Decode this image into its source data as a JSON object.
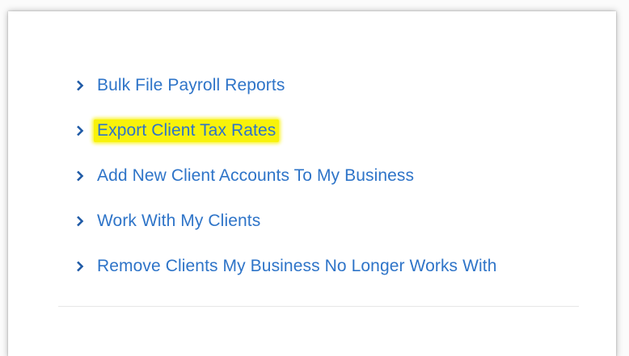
{
  "menu": {
    "items": [
      {
        "label": "Bulk File Payroll Reports",
        "icon": "chevron-right-icon",
        "highlighted": false
      },
      {
        "label": "Export Client Tax Rates",
        "icon": "chevron-right-icon",
        "highlighted": true
      },
      {
        "label": "Add New Client Accounts To My Business",
        "icon": "chevron-right-icon",
        "highlighted": false
      },
      {
        "label": "Work With My Clients",
        "icon": "chevron-right-icon",
        "highlighted": false
      },
      {
        "label": "Remove Clients My Business No Longer Works With",
        "icon": "chevron-right-icon",
        "highlighted": false
      }
    ]
  },
  "colors": {
    "link": "#2e74c8",
    "chevron": "#1f5aa6",
    "highlight": "#f8f20a",
    "divider": "#e7e7e7"
  }
}
